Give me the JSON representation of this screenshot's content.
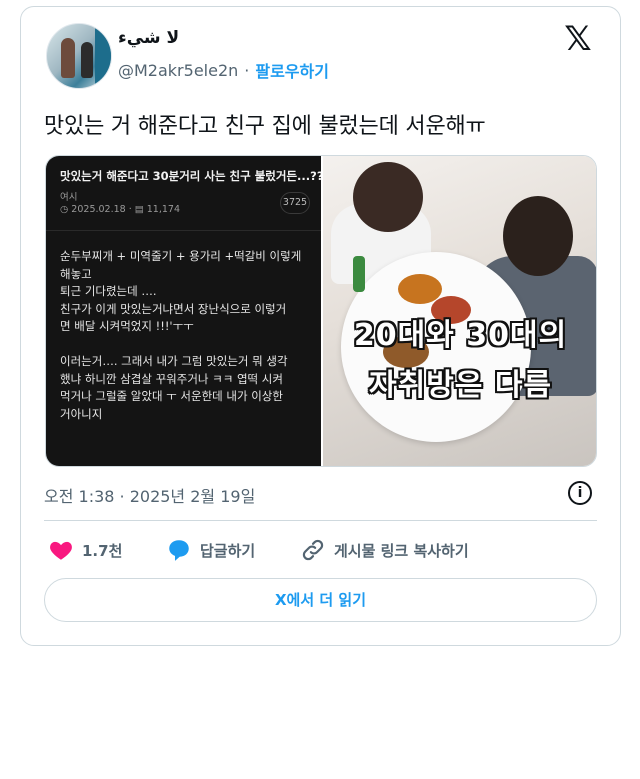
{
  "author": {
    "display_name": "لا شيء",
    "handle": "@M2akr5ele2n",
    "separator": "·",
    "follow_label": "팔로우하기"
  },
  "brand": {
    "logo_glyph": "𝕏",
    "logo_name": "x-logo"
  },
  "tweet": {
    "text": "맛있는 거 해준다고 친구 집에 불렀는데 서운해ㅠ",
    "timestamp": "오전 1:38 · 2025년 2월 19일"
  },
  "media": {
    "left": {
      "title": "맛있는거 해준다고 30분거리 사는 친구 불렀거든...??",
      "meta_label": "여시",
      "meta_stats": "◷ 2025.02.18 · ▤ 11,174",
      "count_badge": "3725",
      "body": "순두부찌개 + 미역줄기 + 용가리 +떡갈비 이렇게\n해놓고\n퇴근 기다렸는데 ….\n친구가 이게 맛있는거냐면서 장난식으로 이렇거\n면 배달 시켜먹었지 !!!'ㅜㅜ\n\n이러는거…. 그래서 내가 그럼 맛있는거 뭐 생각\n했냐 하니깐 삼겹살 꾸워주거나 ㅋㅋ 엽떡 시켜\n먹거나 그럴줄 알았대 ㅜ 서운한데 내가 이상한\n거아니지"
    },
    "right": {
      "overlay_line1": "20대와 30대의",
      "overlay_line2": "자취방은 다름"
    }
  },
  "actions": {
    "like_count": "1.7천",
    "reply_label": "답글하기",
    "share_label": "게시물 링크 복사하기"
  },
  "read_more_label": "X에서 더 읽기",
  "colors": {
    "accent": "#1d9bf0",
    "like": "#f91880",
    "muted": "#536471",
    "border": "#cfd9de"
  }
}
